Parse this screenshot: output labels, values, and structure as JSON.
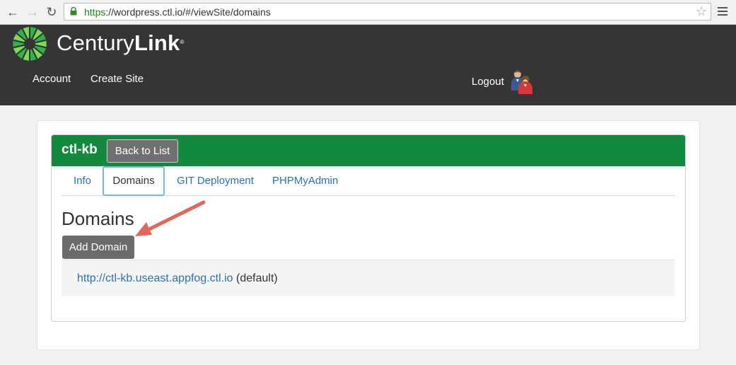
{
  "browser": {
    "url_scheme": "https",
    "url_rest": "://wordpress.ctl.io/#/viewSite/domains",
    "back_icon": "arrow-left",
    "forward_icon": "arrow-right",
    "reload_icon": "reload",
    "bookmark_icon": "star",
    "menu_icon": "hamburger"
  },
  "header": {
    "logo_regular": "Century",
    "logo_bold": "Link",
    "logo_mark": "®",
    "nav": [
      "Account",
      "Create Site"
    ],
    "logout_label": "Logout"
  },
  "site": {
    "name": "ctl-kb",
    "back_label": "Back to List",
    "tabs": [
      {
        "label": "Info",
        "active": false
      },
      {
        "label": "Domains",
        "active": true
      },
      {
        "label": "GIT Deployment",
        "active": false
      },
      {
        "label": "PHPMyAdmin",
        "active": false
      }
    ],
    "section_title": "Domains",
    "add_label": "Add Domain",
    "domains": [
      {
        "url": "http://ctl-kb.useast.appfog.ctl.io",
        "note": "(default)"
      }
    ]
  },
  "colors": {
    "header_bg": "#353535",
    "panel_heading": "#13893f",
    "link": "#2a72b5",
    "annotation_arrow": "#e0685a"
  }
}
